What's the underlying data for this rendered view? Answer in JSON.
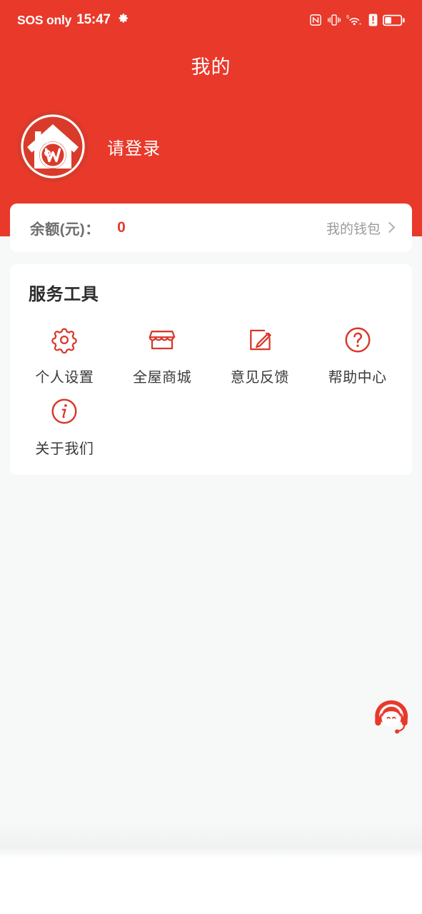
{
  "statusbar": {
    "carrier": "SOS only",
    "time": "15:47",
    "gear_icon": "gear-icon",
    "right_icons": [
      "nfc-icon",
      "vibrate-icon",
      "wifi-6-icon",
      "signal-alert-icon",
      "battery-icon"
    ]
  },
  "header": {
    "title": "我的",
    "brand_color": "#e8392a",
    "avatar_icon": "house-w-logo-icon",
    "login_label": "请登录"
  },
  "balance": {
    "label": "余额(元)：",
    "value": "0",
    "value_color": "#e8392a",
    "wallet_label": "我的钱包",
    "chevron_icon": "chevron-right-icon"
  },
  "tools": {
    "title": "服务工具",
    "accent_color": "#d9382a",
    "items": [
      {
        "label": "个人设置",
        "icon": "gear-icon"
      },
      {
        "label": "全屋商城",
        "icon": "store-icon"
      },
      {
        "label": "意见反馈",
        "icon": "edit-pencil-icon"
      },
      {
        "label": "帮助中心",
        "icon": "question-circle-icon"
      },
      {
        "label": "关于我们",
        "icon": "info-circle-icon"
      }
    ]
  },
  "fab": {
    "icon": "customer-service-agent-icon",
    "color": "#e8392a"
  }
}
